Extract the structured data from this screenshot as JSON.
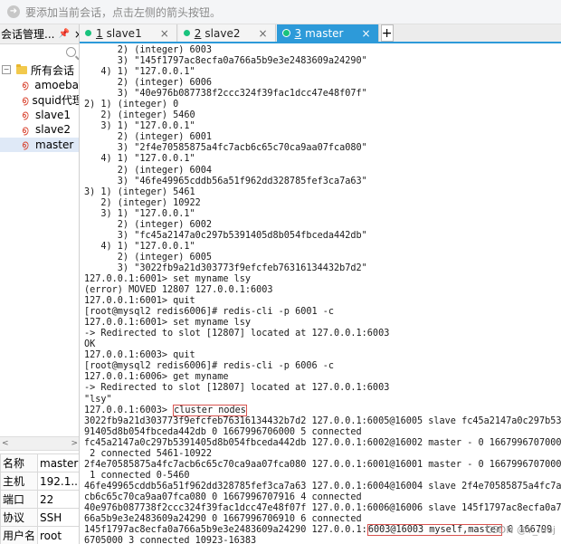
{
  "hint": {
    "text": "要添加当前会话，点击左侧的箭头按钮。"
  },
  "session_panel": {
    "title": "会话管理...",
    "root": "所有会话",
    "sessions": [
      "amoeba",
      "squid代理",
      "slave1",
      "slave2",
      "master"
    ]
  },
  "properties": [
    {
      "key": "名称",
      "value": "master"
    },
    {
      "key": "主机",
      "value": "192.1..."
    },
    {
      "key": "端口",
      "value": "22"
    },
    {
      "key": "协议",
      "value": "SSH"
    },
    {
      "key": "用户名",
      "value": "root"
    },
    {
      "key": "说明",
      "value": ""
    }
  ],
  "tabs": [
    {
      "num": "1",
      "label": "slave1"
    },
    {
      "num": "2",
      "label": "slave2"
    },
    {
      "num": "3",
      "label": "master"
    }
  ],
  "active_tab": "3",
  "terminal": {
    "before": "      2) (integer) 6003\n      3) \"145f1797ac8ecfa0a766a5b9e3e2483609a24290\"\n   4) 1) \"127.0.0.1\"\n      2) (integer) 6006\n      3) \"40e976b087738f2ccc324f39fac1dcc47e48f07f\"\n2) 1) (integer) 0\n   2) (integer) 5460\n   3) 1) \"127.0.0.1\"\n      2) (integer) 6001\n      3) \"2f4e70585875a4fc7acb6c65c70ca9aa07fca080\"\n   4) 1) \"127.0.0.1\"\n      2) (integer) 6004\n      3) \"46fe49965cddb56a51f962dd328785fef3ca7a63\"\n3) 1) (integer) 5461\n   2) (integer) 10922\n   3) 1) \"127.0.0.1\"\n      2) (integer) 6002\n      3) \"fc45a2147a0c297b5391405d8b054fbceda442db\"\n   4) 1) \"127.0.0.1\"\n      2) (integer) 6005\n      3) \"3022fb9a21d303773f9efcfeb76316134432b7d2\"\n127.0.0.1:6001> set myname lsy\n(error) MOVED 12807 127.0.0.1:6003\n127.0.0.1:6001> quit\n[root@mysql2 redis6006]# redis-cli -p 6001 -c\n127.0.0.1:6001> set myname lsy\n-> Redirected to slot [12807] located at 127.0.0.1:6003\nOK\n127.0.0.1:6003> quit\n[root@mysql2 redis6006]# redis-cli -p 6006 -c\n127.0.0.1:6006> get myname\n-> Redirected to slot [12807] located at 127.0.0.1:6003\n\"lsy\"\n127.0.0.1:6003> ",
    "command": "cluster nodes",
    "after": "\n3022fb9a21d303773f9efcfeb76316134432b7d2 127.0.0.1:6005@16005 slave fc45a2147a0c297b53\n91405d8b054fbceda442db 0 1667996706000 5 connected\nfc45a2147a0c297b5391405d8b054fbceda442db 127.0.0.1:6002@16002 master - 0 1667996707000\n 2 connected 5461-10922\n2f4e70585875a4fc7acb6c65c70ca9aa07fca080 127.0.0.1:6001@16001 master - 0 1667996707000\n 1 connected 0-5460\n46fe49965cddb56a51f962dd328785fef3ca7a63 127.0.0.1:6004@16004 slave 2f4e70585875a4fc7a\ncb6c65c70ca9aa07fca080 0 1667996707916 4 connected\n40e976b087738f2ccc324f39fac1dcc47e48f07f 127.0.0.1:6006@16006 slave 145f1797ac8ecfa0a7\n66a5b9e3e2483609a24290 0 1667996706910 6 connected\n145f1797ac8ecfa0a766a5b9e3e2483609a24290 127.0.0.1:",
    "highlight": "6003@16003 myself,master",
    "tail": " 0 166799\n6705000 3 connected 10923-16383"
  },
  "watermark": "CSDN @Y_luoj"
}
